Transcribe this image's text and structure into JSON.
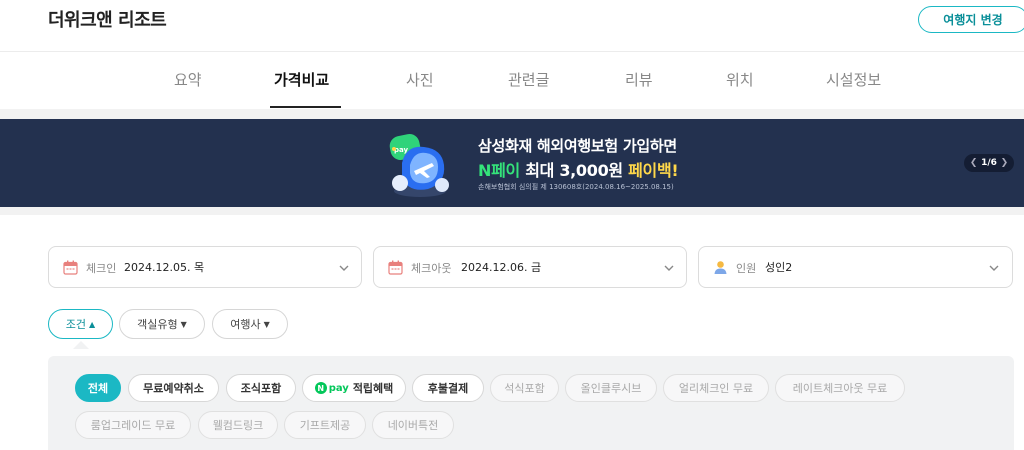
{
  "header": {
    "title": "더위크앤 리조트",
    "change_button": "여행지 변경"
  },
  "tabs": [
    {
      "label": "요약",
      "active": false
    },
    {
      "label": "가격비교",
      "active": true
    },
    {
      "label": "사진",
      "active": false
    },
    {
      "label": "관련글",
      "active": false
    },
    {
      "label": "리뷰",
      "active": false
    },
    {
      "label": "위치",
      "active": false
    },
    {
      "label": "시설정보",
      "active": false
    }
  ],
  "banner": {
    "line1": "삼성화재 해외여행보험 가입하면",
    "line2_a": "N페이",
    "line2_b": " 최대 3,000원 ",
    "line2_c": "페이백!",
    "fine_print": "손해보험협회 심의필 제 130608호(2024.08.16~2025.08.15)",
    "art_badge": "pay",
    "pager": "1/6",
    "colors": {
      "background": "#23314f",
      "green": "#34e37a",
      "yellow": "#ffd84a"
    }
  },
  "search": {
    "checkin": {
      "label": "체크인",
      "value": "2024.12.05. 목",
      "icon": "calendar-icon"
    },
    "checkout": {
      "label": "체크아웃",
      "value": "2024.12.06. 금",
      "icon": "calendar-icon"
    },
    "guests": {
      "label": "인원",
      "value": "성인2",
      "icon": "person-icon"
    }
  },
  "filters": {
    "condition": "조건",
    "room_type": "객실유형",
    "agency": "여행사"
  },
  "chips": {
    "all": "전체",
    "free_cancel": "무료예약취소",
    "breakfast": "조식포함",
    "npay_points": "적립혜택",
    "npay_logo_n": "N",
    "npay_logo_text": "pay",
    "pay_later": "후불결제",
    "dinner": "석식포함",
    "all_inclusive": "올인클루시브",
    "early_checkin": "얼리체크인 무료",
    "late_checkout": "레이트체크아웃 무료",
    "room_upgrade": "룸업그레이드 무료",
    "welcome_drink": "웰컴드링크",
    "gift": "기프트제공",
    "naver_special": "네이버특전"
  },
  "accent_color": "#1bb8c4"
}
